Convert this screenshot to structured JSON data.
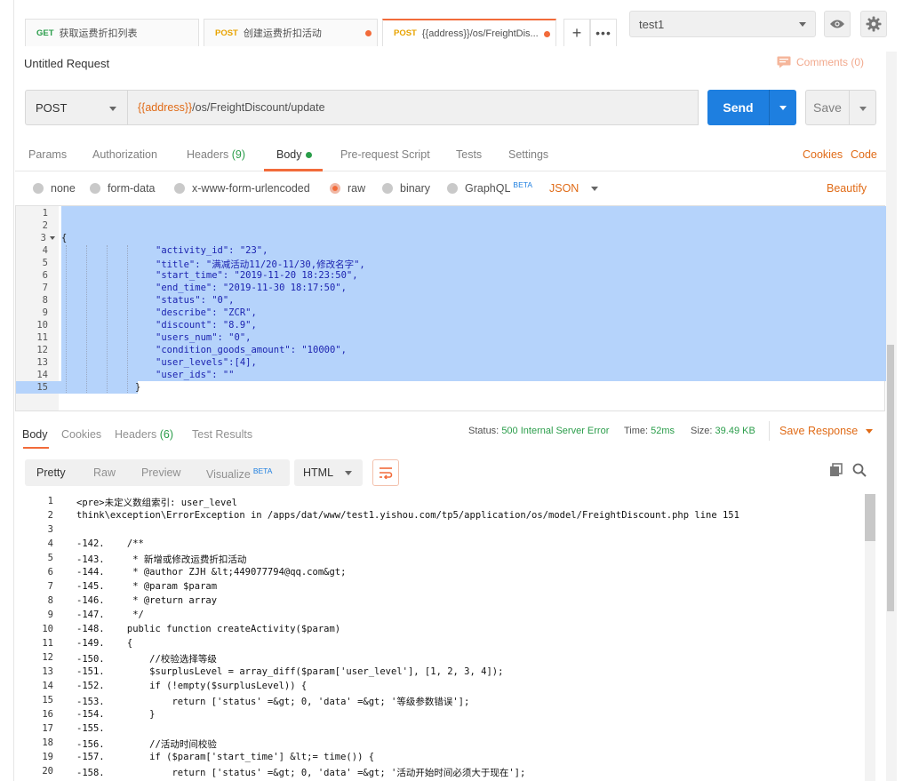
{
  "tabs": [
    {
      "method": "GET",
      "label": "获取运费折扣列表"
    },
    {
      "method": "POST",
      "label": "创建运费折扣活动"
    },
    {
      "method": "POST",
      "label": "{{address}}/os/FreightDis..."
    }
  ],
  "environment": {
    "selected": "test1"
  },
  "request": {
    "title": "Untitled Request",
    "comments_label": "Comments (0)",
    "method": "POST",
    "url_var": "{{address}}",
    "url_path": "/os/FreightDiscount/update",
    "send_label": "Send",
    "save_label": "Save"
  },
  "request_tabs": {
    "params": "Params",
    "authorization": "Authorization",
    "headers": "Headers",
    "headers_count": "(9)",
    "body": "Body",
    "prerequest": "Pre-request Script",
    "tests": "Tests",
    "settings": "Settings",
    "cookies": "Cookies",
    "code": "Code"
  },
  "body_modes": {
    "none": "none",
    "form_data": "form-data",
    "urlencoded": "x-www-form-urlencoded",
    "raw": "raw",
    "binary": "binary",
    "graphql": "GraphQL",
    "beta": "BETA",
    "format": "JSON",
    "beautify": "Beautify"
  },
  "editor": {
    "line_numbers": [
      "1",
      "2",
      "3",
      "4",
      "5",
      "6",
      "7",
      "8",
      "9",
      "10",
      "11",
      "12",
      "13",
      "14",
      "15"
    ],
    "lines": [
      "",
      "",
      "{",
      "\"activity_id\": \"23\",",
      "\"title\": \"满减活动11/20-11/30,修改名字\",",
      "\"start_time\": \"2019-11-20 18:23:50\",",
      "\"end_time\": \"2019-11-30 18:17:50\",",
      "\"status\": \"0\",",
      "\"describe\": \"ZCR\",",
      "\"discount\": \"8.9\",",
      "\"users_num\": \"0\",",
      "\"condition_goods_amount\": \"10000\",",
      "\"user_levels\":[4],",
      "\"user_ids\": \"\"",
      "}"
    ]
  },
  "response_tabs": {
    "body": "Body",
    "cookies": "Cookies",
    "headers": "Headers",
    "headers_count": "(6)",
    "test_results": "Test Results"
  },
  "response_status": {
    "status_label": "Status:",
    "status_value": "500 Internal Server Error",
    "time_label": "Time:",
    "time_value": "52ms",
    "size_label": "Size:",
    "size_value": "39.49 KB",
    "save_response": "Save Response"
  },
  "viewer": {
    "pretty": "Pretty",
    "raw": "Raw",
    "preview": "Preview",
    "visualize": "Visualize",
    "beta": "BETA",
    "format": "HTML"
  },
  "response_body": {
    "line_numbers": [
      "1",
      "2",
      "3",
      "4",
      "5",
      "6",
      "7",
      "8",
      "9",
      "10",
      "11",
      "12",
      "13",
      "14",
      "15",
      "16",
      "17",
      "18",
      "19",
      "20"
    ],
    "lines": [
      "<pre>未定义数组索引: user_level",
      "think\\exception\\ErrorException in /apps/dat/www/test1.yishou.com/tp5/application/os/model/FreightDiscount.php line 151",
      "",
      "-142.    /**",
      "-143.     * 新增或修改运费折扣活动",
      "-144.     * @author ZJH &lt;449077794@qq.com&gt;",
      "-145.     * @param $param",
      "-146.     * @return array",
      "-147.     */",
      "-148.    public function createActivity($param)",
      "-149.    {",
      "-150.        //校验选择等级",
      "-151.        $surplusLevel = array_diff($param['user_level'], [1, 2, 3, 4]);",
      "-152.        if (!empty($surplusLevel)) {",
      "-153.            return ['status' =&gt; 0, 'data' =&gt; '等级参数错误'];",
      "-154.        }",
      "-155.",
      "-156.        //活动时间校验",
      "-157.        if ($param['start_time'] &lt;= time()) {",
      "-158.            return ['status' =&gt; 0, 'data' =&gt; '活动开始时间必须大于现在'];"
    ]
  },
  "colors": {
    "accent": "#f26b3a",
    "send": "#1e7fe0",
    "success": "#2a9d4a",
    "selection": "#b5d3fb"
  }
}
